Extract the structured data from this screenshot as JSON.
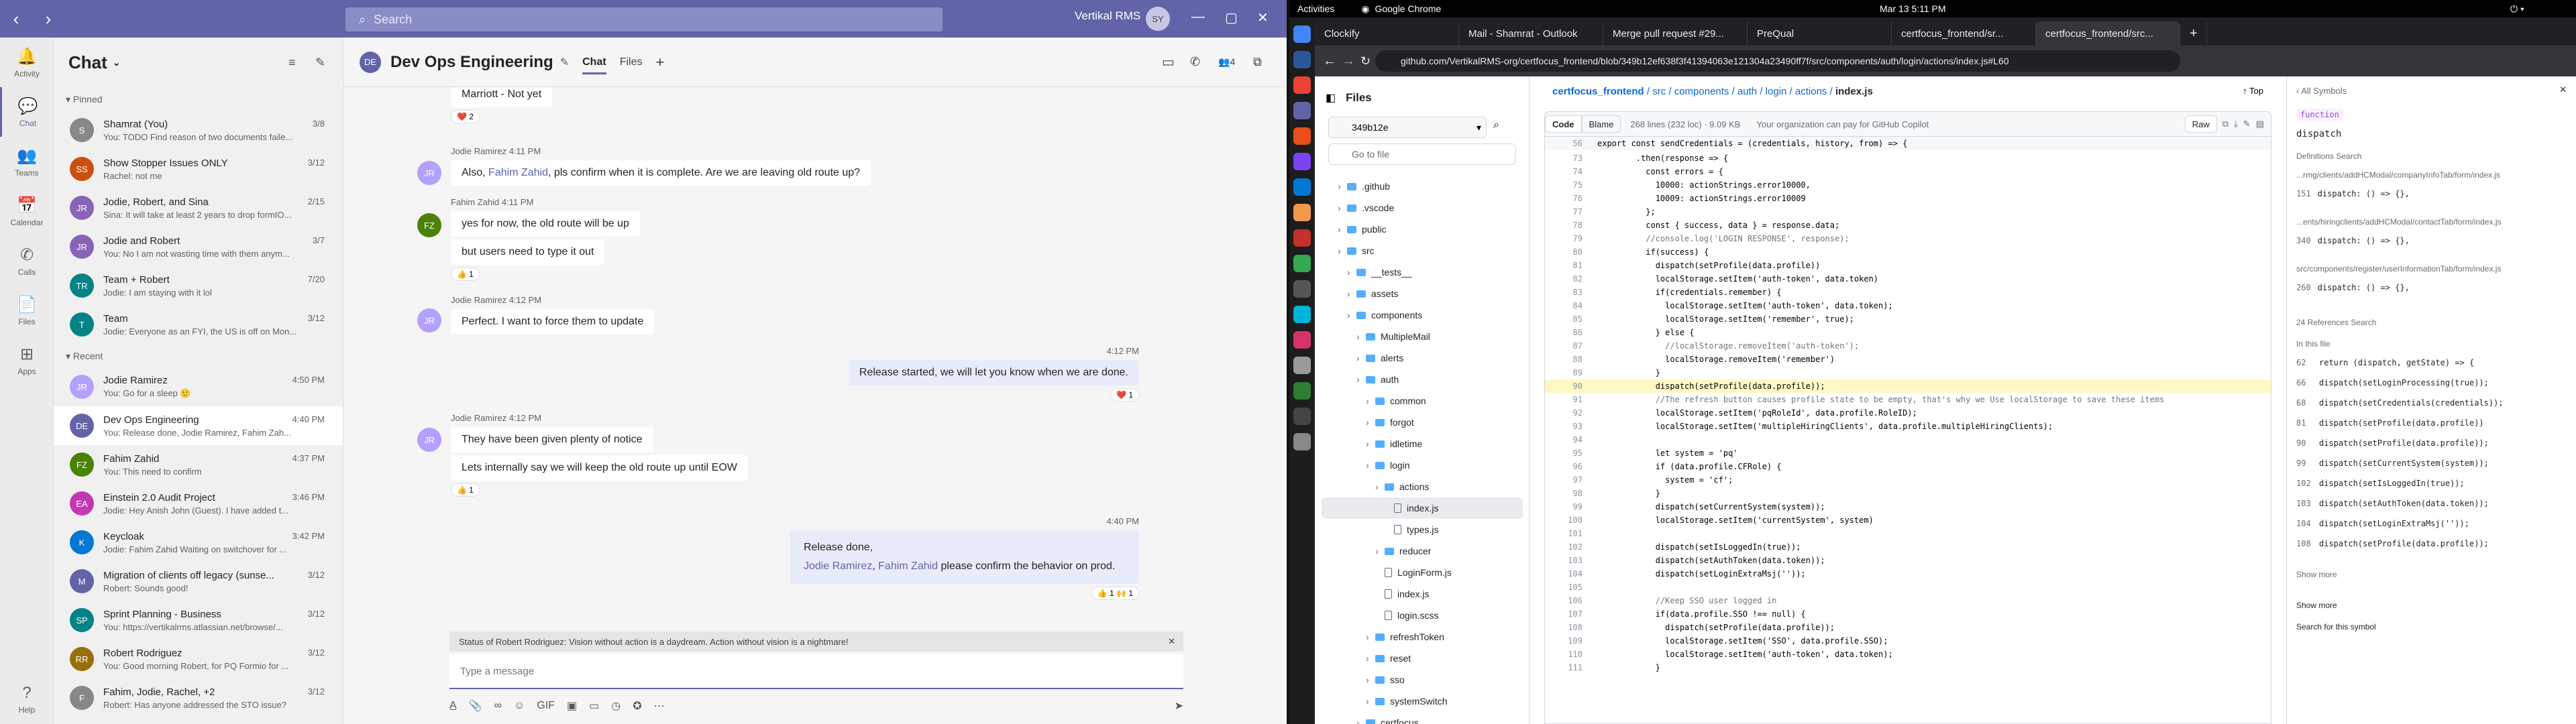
{
  "teams": {
    "search_placeholder": "Search",
    "org": "Vertikal RMS",
    "avatar_initials": "SY",
    "rail": [
      {
        "label": "Activity",
        "icon": "bell-icon"
      },
      {
        "label": "Chat",
        "icon": "chat-icon"
      },
      {
        "label": "Teams",
        "icon": "teams-icon"
      },
      {
        "label": "Calendar",
        "icon": "calendar-icon"
      },
      {
        "label": "Calls",
        "icon": "phone-icon"
      },
      {
        "label": "Files",
        "icon": "file-icon"
      },
      {
        "label": "Apps",
        "icon": "apps-icon"
      },
      {
        "label": "Help",
        "icon": "help-icon"
      }
    ],
    "chat_title": "Chat",
    "pinned_label": "Pinned",
    "recent_label": "Recent",
    "pinned": [
      {
        "name": "Shamrat (You)",
        "time": "3/8",
        "preview": "You: TODO Find reason of two documents faile...",
        "initials": "S",
        "color": "#8a8886"
      },
      {
        "name": "Show Stopper Issues ONLY",
        "time": "3/12",
        "preview": "Rachel: not me",
        "initials": "SS",
        "color": "#ca5010"
      },
      {
        "name": "Jodie, Robert, and Sina",
        "time": "2/15",
        "preview": "Sina: It will take at least 2 years to drop formIO...",
        "initials": "JR",
        "color": "#8764b8"
      },
      {
        "name": "Jodie and Robert",
        "time": "3/7",
        "preview": "You: No I am not wasting time with them anym...",
        "initials": "JR",
        "color": "#8764b8"
      },
      {
        "name": "Team + Robert",
        "time": "7/20",
        "preview": "Jodie: I am staying with it lol",
        "initials": "TR",
        "color": "#038387"
      },
      {
        "name": "Team",
        "time": "3/12",
        "preview": "Jodie: Everyone as an FYI, the US is off on Mon...",
        "initials": "T",
        "color": "#038387"
      }
    ],
    "recent": [
      {
        "name": "Jodie Ramirez",
        "time": "4:50 PM",
        "preview": "You: Go for a sleep 🙂",
        "initials": "JR",
        "color": "#b4a0ff"
      },
      {
        "name": "Dev Ops Engineering",
        "time": "4:40 PM",
        "preview": "You: Release done, Jodie Ramirez, Fahim Zah...",
        "initials": "DE",
        "color": "#6264a7"
      },
      {
        "name": "Fahim Zahid",
        "time": "4:37 PM",
        "preview": "You: This need to confirm",
        "initials": "FZ",
        "color": "#498205"
      },
      {
        "name": "Einstein 2.0 Audit Project",
        "time": "3:46 PM",
        "preview": "Jodie: Hey Anish John (Guest). I have added t...",
        "initials": "EA",
        "color": "#c239b3"
      },
      {
        "name": "Keycloak",
        "time": "3:42 PM",
        "preview": "Jodie: Fahim Zahid Waiting on switchover for ...",
        "initials": "K",
        "color": "#0078d4"
      },
      {
        "name": "Migration of clients off legacy (sunse...",
        "time": "3/12",
        "preview": "Robert: Sounds good!",
        "initials": "M",
        "color": "#6264a7"
      },
      {
        "name": "Sprint Planning - Business",
        "time": "3/12",
        "preview": "You: https://vertikalrms.atlassian.net/browse/...",
        "initials": "SP",
        "color": "#038387"
      },
      {
        "name": "Robert Rodriguez",
        "time": "3/12",
        "preview": "You: Good morning Robert, for PQ Formio for ...",
        "initials": "RR",
        "color": "#986f0b"
      },
      {
        "name": "Fahim, Jodie, Rachel, +2",
        "time": "3/12",
        "preview": "Robert: Has anyone addressed the STO issue?",
        "initials": "F",
        "color": "#8a8886"
      }
    ],
    "conv": {
      "title": "Dev Ops Engineering",
      "tab_chat": "Chat",
      "tab_files": "Files",
      "participants": "4",
      "msg0_tail": "Marriott - Not yet",
      "msg0_rx": "❤️ 2",
      "msg1_meta": "Jodie Ramirez  4:11 PM",
      "msg1_a": "Also, ",
      "msg1_mention": "Fahim Zahid",
      "msg1_b": ", pls confirm when it is complete.  Are we are leaving old route up?",
      "msg2_meta": "Fahim Zahid  4:11 PM",
      "msg2_a": "yes for now, the old route will be up",
      "msg2_b": "but users need to type it out",
      "msg2_rx": "👍 1",
      "msg3_meta": "Jodie Ramirez  4:12 PM",
      "msg3": "Perfect.  I want to force them to update",
      "msg4_time": "4:12 PM",
      "msg4": "Release started, we will let you know when we are done.",
      "msg4_rx": "❤️ 1",
      "msg5_meta": "Jodie Ramirez  4:12 PM",
      "msg5_a": "They have been given plenty of notice",
      "msg5_b": "Lets internally say we will keep the old route up until EOW",
      "msg5_rx": "👍 1",
      "msg6_time": "4:40 PM",
      "msg6_a": "Release done,",
      "msg6_m1": "Jodie Ramirez",
      "msg6_m2": "Fahim Zahid",
      "msg6_b": " please confirm the behavior on prod.",
      "msg6_rx": "👍 1   🙌 1",
      "status": "Status of Robert Rodriguez: Vision without action is a daydream. Action without vision is a nightmare!",
      "compose_placeholder": "Type a message"
    }
  },
  "system": {
    "activities": "Activities",
    "app": "Google Chrome",
    "clock": "Mar 13  5:11 PM"
  },
  "chrome": {
    "tabs": [
      "Clockify",
      "Mail - Shamrat - Outlook",
      "Merge pull request #29...",
      "PreQual",
      "certfocus_frontend/sr...",
      "certfocus_frontend/src..."
    ],
    "url": "github.com/VertikalRMS-org/certfocus_frontend/blob/349b12ef638f3f41394063e121304a23490ff7f/src/components/auth/login/actions/index.js#L60"
  },
  "github": {
    "files_title": "Files",
    "branch": "349b12e",
    "goto_placeholder": "Go to file",
    "tree": [
      {
        "name": ".github",
        "lvl": 1,
        "t": "d"
      },
      {
        "name": ".vscode",
        "lvl": 1,
        "t": "d"
      },
      {
        "name": "public",
        "lvl": 1,
        "t": "d"
      },
      {
        "name": "src",
        "lvl": 1,
        "t": "d"
      },
      {
        "name": "__tests__",
        "lvl": 2,
        "t": "d"
      },
      {
        "name": "assets",
        "lvl": 2,
        "t": "d"
      },
      {
        "name": "components",
        "lvl": 2,
        "t": "d"
      },
      {
        "name": "MultipleMail",
        "lvl": 3,
        "t": "d"
      },
      {
        "name": "alerts",
        "lvl": 3,
        "t": "d"
      },
      {
        "name": "auth",
        "lvl": 3,
        "t": "d"
      },
      {
        "name": "common",
        "lvl": 4,
        "t": "d"
      },
      {
        "name": "forgot",
        "lvl": 4,
        "t": "d"
      },
      {
        "name": "idletime",
        "lvl": 4,
        "t": "d"
      },
      {
        "name": "login",
        "lvl": 4,
        "t": "d"
      },
      {
        "name": "actions",
        "lvl": 5,
        "t": "d"
      },
      {
        "name": "index.js",
        "lvl": 6,
        "t": "f",
        "sel": true
      },
      {
        "name": "types.js",
        "lvl": 6,
        "t": "f"
      },
      {
        "name": "reducer",
        "lvl": 5,
        "t": "d"
      },
      {
        "name": "LoginForm.js",
        "lvl": 5,
        "t": "f"
      },
      {
        "name": "index.js",
        "lvl": 5,
        "t": "f"
      },
      {
        "name": "login.scss",
        "lvl": 5,
        "t": "f"
      },
      {
        "name": "refreshToken",
        "lvl": 4,
        "t": "d"
      },
      {
        "name": "reset",
        "lvl": 4,
        "t": "d"
      },
      {
        "name": "sso",
        "lvl": 4,
        "t": "d"
      },
      {
        "name": "systemSwitch",
        "lvl": 4,
        "t": "d"
      },
      {
        "name": "certfocus",
        "lvl": 3,
        "t": "d"
      }
    ],
    "crumb_parts": [
      "certfocus_frontend",
      "src",
      "components",
      "auth",
      "login",
      "actions"
    ],
    "crumb_file": "index.js",
    "top_label": "Top",
    "code_tab": "Code",
    "blame_tab": "Blame",
    "file_info": "268 lines (232 loc) · 9.09 KB",
    "copilot_note": "Your organization can pay for GitHub Copilot",
    "raw": "Raw",
    "func_header": "export const sendCredentials = (credentials, history, from) => {",
    "lines": [
      {
        "n": "73",
        "c": "        .then(response => {"
      },
      {
        "n": "74",
        "c": "          const errors = {"
      },
      {
        "n": "75",
        "c": "            10000: actionStrings.error10000,"
      },
      {
        "n": "76",
        "c": "            10009: actionStrings.error10009"
      },
      {
        "n": "77",
        "c": "          };"
      },
      {
        "n": "78",
        "c": "          const { success, data } = response.data;"
      },
      {
        "n": "79",
        "c": "          //console.log('LOGIN RESPONSE', response);"
      },
      {
        "n": "80",
        "c": "          if(success) {"
      },
      {
        "n": "81",
        "c": "            dispatch(setProfile(data.profile))"
      },
      {
        "n": "82",
        "c": "            localStorage.setItem('auth-token', data.token)"
      },
      {
        "n": "83",
        "c": "            if(credentials.remember) {"
      },
      {
        "n": "84",
        "c": "              localStorage.setItem('auth-token', data.token);"
      },
      {
        "n": "85",
        "c": "              localStorage.setItem('remember', true);"
      },
      {
        "n": "86",
        "c": "            } else {"
      },
      {
        "n": "87",
        "c": "              //localStorage.removeItem('auth-token');"
      },
      {
        "n": "88",
        "c": "              localStorage.removeItem('remember')"
      },
      {
        "n": "89",
        "c": "            }"
      },
      {
        "n": "90",
        "c": "            dispatch(setProfile(data.profile));"
      },
      {
        "n": "91",
        "c": "            //The refresh button causes profile state to be empty, that's why we Use localStorage to save these items"
      },
      {
        "n": "92",
        "c": "            localStorage.setItem('pqRoleId', data.profile.RoleID);"
      },
      {
        "n": "93",
        "c": "            localStorage.setItem('multipleHiringClients', data.profile.multipleHiringClients);"
      },
      {
        "n": "94",
        "c": ""
      },
      {
        "n": "95",
        "c": "            let system = 'pq'"
      },
      {
        "n": "96",
        "c": "            if (data.profile.CFRole) {"
      },
      {
        "n": "97",
        "c": "              system = 'cf';"
      },
      {
        "n": "98",
        "c": "            }"
      },
      {
        "n": "99",
        "c": "            dispatch(setCurrentSystem(system));"
      },
      {
        "n": "100",
        "c": "            localStorage.setItem('currentSystem', system)"
      },
      {
        "n": "101",
        "c": ""
      },
      {
        "n": "102",
        "c": "            dispatch(setIsLoggedIn(true));"
      },
      {
        "n": "103",
        "c": "            dispatch(setAuthToken(data.token));"
      },
      {
        "n": "104",
        "c": "            dispatch(setLoginExtraMsj(''));"
      },
      {
        "n": "105",
        "c": ""
      },
      {
        "n": "106",
        "c": "            //Keep SSO user logged in"
      },
      {
        "n": "107",
        "c": "            if(data.profile.SSO !== null) {"
      },
      {
        "n": "108",
        "c": "              dispatch(setProfile(data.profile));"
      },
      {
        "n": "109",
        "c": "              localStorage.setItem('SSO', data.profile.SSO);"
      },
      {
        "n": "110",
        "c": "              localStorage.setItem('auth-token', data.token);"
      },
      {
        "n": "111",
        "c": "            }"
      }
    ],
    "sym_title": "All Symbols",
    "sym_kind": "function",
    "sym_name": "dispatch",
    "defs_label": "Definitions",
    "search_label": "Search",
    "defs": [
      {
        "path": "...rmg/clients/addHCModal/companyInfoTab/form/index.js",
        "ln": "151",
        "code": "dispatch: () => {},"
      },
      {
        "path": "...ents/hiringclients/addHCModal/contactTab/form/index.js",
        "ln": "340",
        "code": "dispatch: () => {},"
      },
      {
        "path": "src/components/register/userInformationTab/form/index.js",
        "ln": "260",
        "code": "dispatch: () => {},"
      }
    ],
    "refs_label": "24 References",
    "in_file": "In this file",
    "refs": [
      {
        "ln": "62",
        "code": "return (dispatch, getState) => {"
      },
      {
        "ln": "66",
        "code": "dispatch(setLoginProcessing(true));"
      },
      {
        "ln": "68",
        "code": "dispatch(setCredentials(credentials));"
      },
      {
        "ln": "81",
        "code": "dispatch(setProfile(data.profile))"
      },
      {
        "ln": "90",
        "code": "dispatch(setProfile(data.profile));"
      },
      {
        "ln": "99",
        "code": "dispatch(setCurrentSystem(system));"
      },
      {
        "ln": "102",
        "code": "dispatch(setIsLoggedIn(true));"
      },
      {
        "ln": "103",
        "code": "dispatch(setAuthToken(data.token));"
      },
      {
        "ln": "104",
        "code": "dispatch(setLoginExtraMsj(''));"
      },
      {
        "ln": "108",
        "code": "dispatch(setProfile(data.profile));"
      }
    ],
    "show_more": "Show more",
    "search_symbol": "Search for this symbol"
  }
}
